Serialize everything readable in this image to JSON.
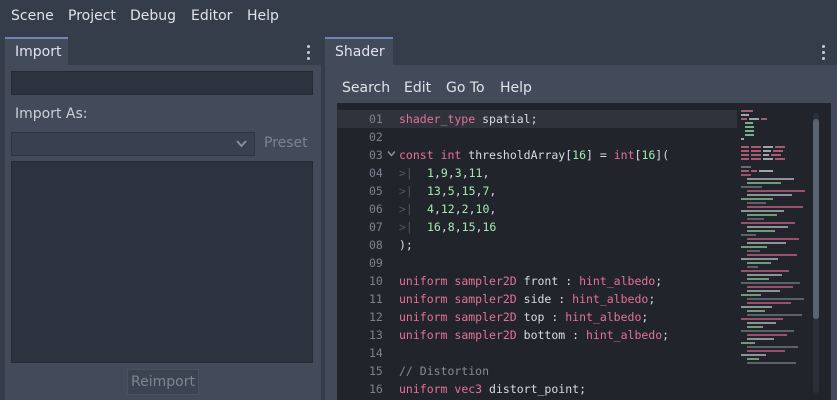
{
  "menubar": {
    "items": [
      "Scene",
      "Project",
      "Debug",
      "Editor",
      "Help"
    ]
  },
  "import_dock": {
    "tab": "Import",
    "import_as_label": "Import As:",
    "preset_label": "Preset",
    "reimport_label": "Reimport"
  },
  "shader_dock": {
    "tab": "Shader",
    "menu": [
      "Search",
      "Edit",
      "Go To",
      "Help"
    ]
  },
  "code_lines": [
    {
      "n": "01",
      "text": "shader_type spatial;"
    },
    {
      "n": "02",
      "text": ""
    },
    {
      "n": "03",
      "text": "const int thresholdArray[16] = int[16]("
    },
    {
      "n": "04",
      "text": "1,9,3,11,"
    },
    {
      "n": "05",
      "text": "13,5,15,7,"
    },
    {
      "n": "06",
      "text": "4,12,2,10,"
    },
    {
      "n": "07",
      "text": "16,8,15,16"
    },
    {
      "n": "08",
      "text": ");"
    },
    {
      "n": "09",
      "text": ""
    },
    {
      "n": "10",
      "text": "uniform sampler2D front : hint_albedo;"
    },
    {
      "n": "11",
      "text": "uniform sampler2D side : hint_albedo;"
    },
    {
      "n": "12",
      "text": "uniform sampler2D top : hint_albedo;"
    },
    {
      "n": "13",
      "text": "uniform sampler2D bottom : hint_albedo;"
    },
    {
      "n": "14",
      "text": ""
    },
    {
      "n": "15",
      "text": "// Distortion"
    },
    {
      "n": "16",
      "text": "uniform vec3 distort_point;"
    }
  ],
  "colors": {
    "keyword": "#e57196",
    "number": "#a3e9b3",
    "comment": "#848b97",
    "accent": "#6f86b3"
  }
}
